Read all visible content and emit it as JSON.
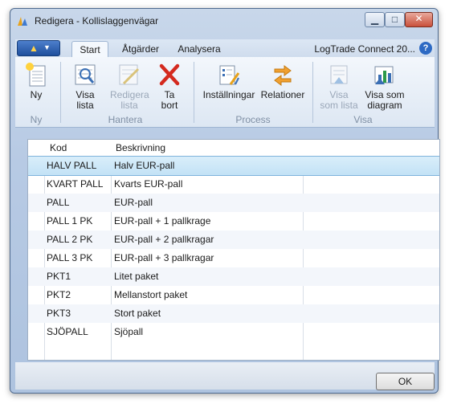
{
  "window": {
    "title": "Redigera - Kollislaggenvägar"
  },
  "ribbon": {
    "tabs": [
      {
        "label": "Start"
      },
      {
        "label": "Åtgärder"
      },
      {
        "label": "Analysera"
      }
    ],
    "connection_label": "LogTrade Connect 20...",
    "help_glyph": "?",
    "buttons": {
      "ny": {
        "label": "Ny",
        "icon": "new-document-icon"
      },
      "visa_lista": {
        "line1": "Visa",
        "line2": "lista",
        "icon": "view-list-icon"
      },
      "redigera_lista": {
        "line1": "Redigera",
        "line2": "lista",
        "icon": "edit-list-icon",
        "disabled": true
      },
      "ta_bort": {
        "line1": "Ta",
        "line2": "bort",
        "icon": "delete-x-icon"
      },
      "installningar": {
        "label": "Inställningar",
        "icon": "settings-icon"
      },
      "relationer": {
        "label": "Relationer",
        "icon": "relations-icon"
      },
      "visa_som_lista": {
        "line1": "Visa",
        "line2": "som lista",
        "icon": "list-view-icon",
        "disabled": true
      },
      "visa_som_diagram": {
        "line1": "Visa som",
        "line2": "diagram",
        "icon": "chart-view-icon"
      }
    },
    "groups": {
      "ny": "Ny",
      "hantera": "Hantera",
      "process": "Process",
      "visa": "Visa"
    }
  },
  "table": {
    "columns": {
      "kod": "Kod",
      "beskrivning": "Beskrivning"
    },
    "rows": [
      {
        "kod": "HALV PALL",
        "beskrivning": "Halv EUR-pall"
      },
      {
        "kod": "KVART PALL",
        "beskrivning": "Kvarts EUR-pall"
      },
      {
        "kod": "PALL",
        "beskrivning": "EUR-pall"
      },
      {
        "kod": "PALL 1 PK",
        "beskrivning": "EUR-pall + 1 pallkrage"
      },
      {
        "kod": "PALL 2 PK",
        "beskrivning": "EUR-pall + 2 pallkragar"
      },
      {
        "kod": "PALL 3 PK",
        "beskrivning": "EUR-pall + 3 pallkragar"
      },
      {
        "kod": "PKT1",
        "beskrivning": "Litet paket"
      },
      {
        "kod": "PKT2",
        "beskrivning": "Mellanstort paket"
      },
      {
        "kod": "PKT3",
        "beskrivning": "Stort paket"
      },
      {
        "kod": "SJÖPALL",
        "beskrivning": "Sjöpall"
      }
    ],
    "selected_row": "HALV PALL"
  },
  "footer": {
    "ok_label": "OK"
  },
  "colors": {
    "accent": "#2d6ac4",
    "selection": "#c3e2f6",
    "delete_red": "#d42a1f"
  }
}
